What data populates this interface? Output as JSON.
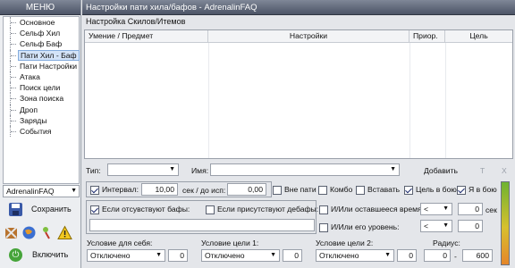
{
  "left": {
    "header": "МЕНЮ",
    "menu": [
      "Основное",
      "Сельф Хил",
      "Сельф Баф",
      "Пати Хил - Баф",
      "Пати Настройки",
      "Атака",
      "Поиск цели",
      "Зона поиска",
      "Дроп",
      "Заряды",
      "События"
    ],
    "selected_index": 3,
    "profile": "AdrenalinFAQ",
    "save_label": "Сохранить",
    "enable_label": "Включить",
    "icons": [
      "sword-shield-icon",
      "globe-icon",
      "pin-icon",
      "warning-icon"
    ]
  },
  "window_title": "Настройки пати хила/бафов  -  AdrenalinFAQ",
  "section_label": "Настройка Скилов/Итемов",
  "grid": {
    "columns": [
      "Умение / Предмет",
      "Настройки",
      "Приор.",
      "Цель"
    ]
  },
  "filter": {
    "type_label": "Тип:",
    "type_value": "",
    "name_label": "Имя:",
    "name_value": "",
    "add_label": "Добавить",
    "t_label": "T",
    "x_label": "X"
  },
  "options": {
    "interval_label": "Интервал:",
    "interval_checked": true,
    "interval_value": "10,00",
    "interval_unit": "сек / до исп:",
    "before_use_value": "0,00",
    "out_of_party_label": "Вне пати",
    "out_of_party_checked": false,
    "combo_label": "Комбо",
    "combo_checked": false,
    "insert_label": "Вставать",
    "insert_checked": false,
    "target_in_combat_label": "Цель в бою",
    "target_in_combat_checked": true,
    "self_in_combat_label": "Я в бою",
    "self_in_combat_checked": true,
    "missing_buffs_label": "Если отсувствуют бафы:",
    "missing_buffs_checked": true,
    "present_debuffs_label": "Если присутствуют дебафы:",
    "present_debuffs_checked": false,
    "remaining_time_label": "И/Или оставшееся время:",
    "remaining_time_checked": false,
    "remaining_time_op": "<",
    "remaining_time_value": "0",
    "remaining_time_unit": "сек",
    "level_label": "И/Или его уровень:",
    "level_checked": false,
    "level_op": "<",
    "level_value": "0"
  },
  "conditions": {
    "self_label": "Условие для себя:",
    "self_value": "Отключено",
    "self_num": "0",
    "target1_label": "Условие цели 1:",
    "target1_value": "Отключено",
    "target1_num": "0",
    "target2_label": "Условие цели 2:",
    "target2_value": "Отключено",
    "target2_num": "0",
    "radius_label": "Радиус:",
    "radius_min": "0",
    "radius_sep": "-",
    "radius_max": "600"
  }
}
